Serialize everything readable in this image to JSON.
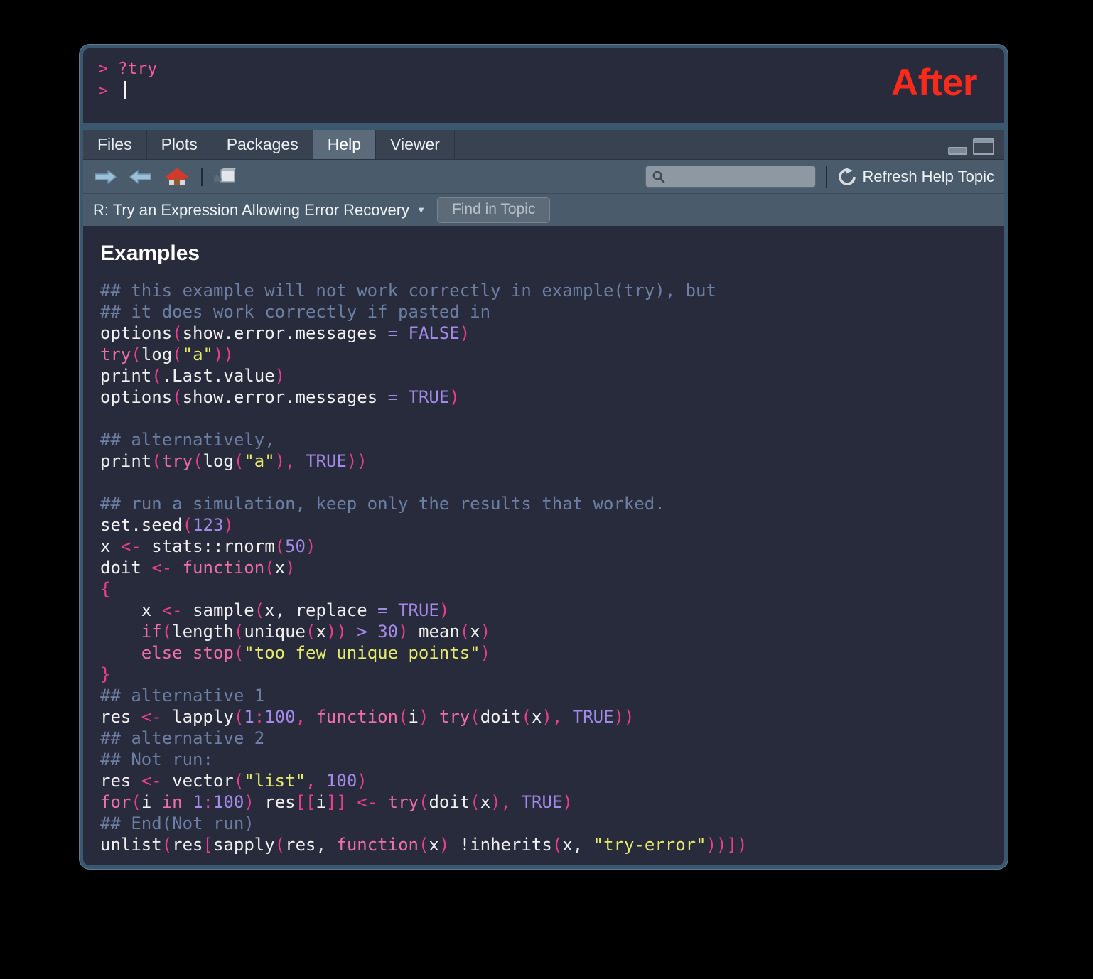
{
  "annotation": {
    "label": "After",
    "color": "#f92a1c"
  },
  "console": {
    "lines": [
      {
        "prompt": ">",
        "command": "?try"
      },
      {
        "prompt": ">",
        "command": ""
      }
    ]
  },
  "tabs": [
    {
      "label": "Files",
      "active": false
    },
    {
      "label": "Plots",
      "active": false
    },
    {
      "label": "Packages",
      "active": false
    },
    {
      "label": "Help",
      "active": true
    },
    {
      "label": "Viewer",
      "active": false
    }
  ],
  "window_controls": {
    "minimize": "minimize-icon",
    "maximize": "maximize-icon"
  },
  "toolbar": {
    "back_icon": "back-arrow-icon",
    "forward_icon": "forward-arrow-icon",
    "home_icon": "home-icon",
    "popout_icon": "show-in-new-window-icon",
    "search_icon": "search-icon",
    "search_value": "",
    "search_placeholder": "",
    "refresh_icon": "refresh-icon",
    "refresh_label": "Refresh Help Topic"
  },
  "topic_bar": {
    "title": "R: Try an Expression Allowing Error Recovery",
    "caret_icon": "chevron-down-icon",
    "find_button_label": "Find in Topic"
  },
  "help": {
    "heading": "Examples",
    "code_lines": [
      [
        {
          "t": "c",
          "v": "## this example will not work correctly in example(try), but"
        }
      ],
      [
        {
          "t": "c",
          "v": "## it does work correctly if pasted in"
        }
      ],
      [
        {
          "t": "t",
          "v": "options"
        },
        {
          "t": "p",
          "v": "("
        },
        {
          "t": "t",
          "v": "show.error.messages "
        },
        {
          "t": "n",
          "v": "= "
        },
        {
          "t": "n",
          "v": "FALSE"
        },
        {
          "t": "p",
          "v": ")"
        }
      ],
      [
        {
          "t": "k",
          "v": "try"
        },
        {
          "t": "p",
          "v": "("
        },
        {
          "t": "t",
          "v": "log"
        },
        {
          "t": "p",
          "v": "("
        },
        {
          "t": "s",
          "v": "\"a\""
        },
        {
          "t": "p",
          "v": "))"
        }
      ],
      [
        {
          "t": "t",
          "v": "print"
        },
        {
          "t": "p",
          "v": "("
        },
        {
          "t": "t",
          "v": ".Last.value"
        },
        {
          "t": "p",
          "v": ")"
        }
      ],
      [
        {
          "t": "t",
          "v": "options"
        },
        {
          "t": "p",
          "v": "("
        },
        {
          "t": "t",
          "v": "show.error.messages "
        },
        {
          "t": "n",
          "v": "= "
        },
        {
          "t": "n",
          "v": "TRUE"
        },
        {
          "t": "p",
          "v": ")"
        }
      ],
      [
        {
          "t": "t",
          "v": ""
        }
      ],
      [
        {
          "t": "c",
          "v": "## alternatively,"
        }
      ],
      [
        {
          "t": "t",
          "v": "print"
        },
        {
          "t": "p",
          "v": "("
        },
        {
          "t": "k",
          "v": "try"
        },
        {
          "t": "p",
          "v": "("
        },
        {
          "t": "t",
          "v": "log"
        },
        {
          "t": "p",
          "v": "("
        },
        {
          "t": "s",
          "v": "\"a\""
        },
        {
          "t": "p",
          "v": "), "
        },
        {
          "t": "n",
          "v": "TRUE"
        },
        {
          "t": "p",
          "v": "))"
        }
      ],
      [
        {
          "t": "t",
          "v": ""
        }
      ],
      [
        {
          "t": "c",
          "v": "## run a simulation, keep only the results that worked."
        }
      ],
      [
        {
          "t": "t",
          "v": "set.seed"
        },
        {
          "t": "p",
          "v": "("
        },
        {
          "t": "n",
          "v": "123"
        },
        {
          "t": "p",
          "v": ")"
        }
      ],
      [
        {
          "t": "t",
          "v": "x "
        },
        {
          "t": "p",
          "v": "<- "
        },
        {
          "t": "t",
          "v": "stats::rnorm"
        },
        {
          "t": "p",
          "v": "("
        },
        {
          "t": "n",
          "v": "50"
        },
        {
          "t": "p",
          "v": ")"
        }
      ],
      [
        {
          "t": "t",
          "v": "doit "
        },
        {
          "t": "p",
          "v": "<- "
        },
        {
          "t": "k",
          "v": "function"
        },
        {
          "t": "p",
          "v": "("
        },
        {
          "t": "t",
          "v": "x"
        },
        {
          "t": "p",
          "v": ")"
        }
      ],
      [
        {
          "t": "p",
          "v": "{"
        }
      ],
      [
        {
          "t": "t",
          "v": "    x "
        },
        {
          "t": "p",
          "v": "<- "
        },
        {
          "t": "t",
          "v": "sample"
        },
        {
          "t": "p",
          "v": "("
        },
        {
          "t": "t",
          "v": "x, replace "
        },
        {
          "t": "n",
          "v": "= "
        },
        {
          "t": "n",
          "v": "TRUE"
        },
        {
          "t": "p",
          "v": ")"
        }
      ],
      [
        {
          "t": "t",
          "v": "    "
        },
        {
          "t": "k",
          "v": "if"
        },
        {
          "t": "p",
          "v": "("
        },
        {
          "t": "t",
          "v": "length"
        },
        {
          "t": "p",
          "v": "("
        },
        {
          "t": "t",
          "v": "unique"
        },
        {
          "t": "p",
          "v": "("
        },
        {
          "t": "t",
          "v": "x"
        },
        {
          "t": "p",
          "v": ")) "
        },
        {
          "t": "n",
          "v": "> "
        },
        {
          "t": "n",
          "v": "30"
        },
        {
          "t": "p",
          "v": ") "
        },
        {
          "t": "t",
          "v": "mean"
        },
        {
          "t": "p",
          "v": "("
        },
        {
          "t": "t",
          "v": "x"
        },
        {
          "t": "p",
          "v": ")"
        }
      ],
      [
        {
          "t": "t",
          "v": "    "
        },
        {
          "t": "k",
          "v": "else "
        },
        {
          "t": "k",
          "v": "stop"
        },
        {
          "t": "p",
          "v": "("
        },
        {
          "t": "s",
          "v": "\"too few unique points\""
        },
        {
          "t": "p",
          "v": ")"
        }
      ],
      [
        {
          "t": "p",
          "v": "}"
        }
      ],
      [
        {
          "t": "c",
          "v": "## alternative 1"
        }
      ],
      [
        {
          "t": "t",
          "v": "res "
        },
        {
          "t": "p",
          "v": "<- "
        },
        {
          "t": "t",
          "v": "lapply"
        },
        {
          "t": "p",
          "v": "("
        },
        {
          "t": "n",
          "v": "1"
        },
        {
          "t": "p",
          "v": ":"
        },
        {
          "t": "n",
          "v": "100"
        },
        {
          "t": "p",
          "v": ", "
        },
        {
          "t": "k",
          "v": "function"
        },
        {
          "t": "p",
          "v": "("
        },
        {
          "t": "t",
          "v": "i"
        },
        {
          "t": "p",
          "v": ") "
        },
        {
          "t": "k",
          "v": "try"
        },
        {
          "t": "p",
          "v": "("
        },
        {
          "t": "t",
          "v": "doit"
        },
        {
          "t": "p",
          "v": "("
        },
        {
          "t": "t",
          "v": "x"
        },
        {
          "t": "p",
          "v": "), "
        },
        {
          "t": "n",
          "v": "TRUE"
        },
        {
          "t": "p",
          "v": "))"
        }
      ],
      [
        {
          "t": "c",
          "v": "## alternative 2"
        }
      ],
      [
        {
          "t": "c",
          "v": "## Not run:"
        }
      ],
      [
        {
          "t": "t",
          "v": "res "
        },
        {
          "t": "p",
          "v": "<- "
        },
        {
          "t": "t",
          "v": "vector"
        },
        {
          "t": "p",
          "v": "("
        },
        {
          "t": "s",
          "v": "\"list\""
        },
        {
          "t": "p",
          "v": ", "
        },
        {
          "t": "n",
          "v": "100"
        },
        {
          "t": "p",
          "v": ")"
        }
      ],
      [
        {
          "t": "k",
          "v": "for"
        },
        {
          "t": "p",
          "v": "("
        },
        {
          "t": "t",
          "v": "i "
        },
        {
          "t": "k",
          "v": "in "
        },
        {
          "t": "n",
          "v": "1"
        },
        {
          "t": "p",
          "v": ":"
        },
        {
          "t": "n",
          "v": "100"
        },
        {
          "t": "p",
          "v": ") "
        },
        {
          "t": "t",
          "v": "res"
        },
        {
          "t": "p",
          "v": "[["
        },
        {
          "t": "t",
          "v": "i"
        },
        {
          "t": "p",
          "v": "]] <- "
        },
        {
          "t": "k",
          "v": "try"
        },
        {
          "t": "p",
          "v": "("
        },
        {
          "t": "t",
          "v": "doit"
        },
        {
          "t": "p",
          "v": "("
        },
        {
          "t": "t",
          "v": "x"
        },
        {
          "t": "p",
          "v": "), "
        },
        {
          "t": "n",
          "v": "TRUE"
        },
        {
          "t": "p",
          "v": ")"
        }
      ],
      [
        {
          "t": "c",
          "v": "## End(Not run)"
        }
      ],
      [
        {
          "t": "t",
          "v": "unlist"
        },
        {
          "t": "p",
          "v": "("
        },
        {
          "t": "t",
          "v": "res"
        },
        {
          "t": "p",
          "v": "["
        },
        {
          "t": "t",
          "v": "sapply"
        },
        {
          "t": "p",
          "v": "("
        },
        {
          "t": "t",
          "v": "res, "
        },
        {
          "t": "k",
          "v": "function"
        },
        {
          "t": "p",
          "v": "("
        },
        {
          "t": "t",
          "v": "x"
        },
        {
          "t": "p",
          "v": ") "
        },
        {
          "t": "t",
          "v": "!inherits"
        },
        {
          "t": "p",
          "v": "("
        },
        {
          "t": "t",
          "v": "x, "
        },
        {
          "t": "s",
          "v": "\"try-error\""
        },
        {
          "t": "p",
          "v": "))])"
        }
      ]
    ]
  }
}
